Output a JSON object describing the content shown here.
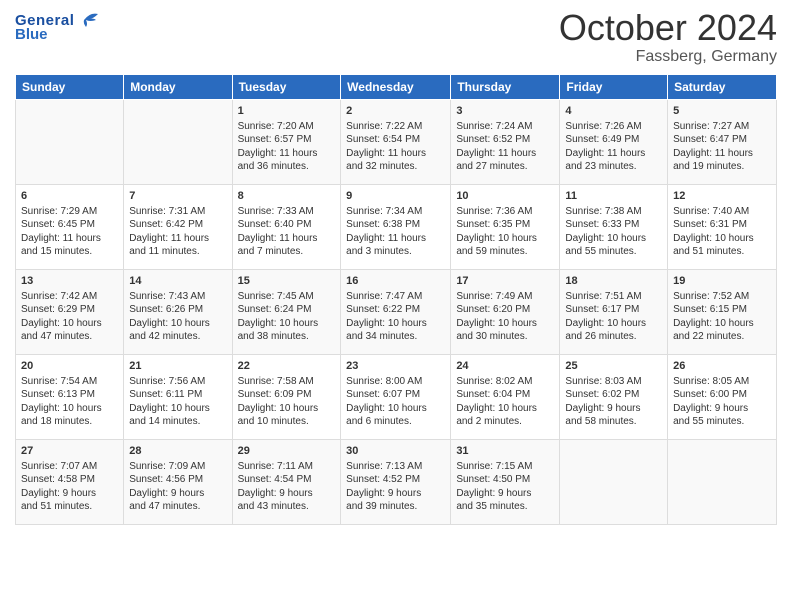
{
  "logo": {
    "text_general": "General",
    "text_blue": "Blue"
  },
  "header": {
    "month": "October 2024",
    "location": "Fassberg, Germany"
  },
  "weekdays": [
    "Sunday",
    "Monday",
    "Tuesday",
    "Wednesday",
    "Thursday",
    "Friday",
    "Saturday"
  ],
  "weeks": [
    [
      {
        "day": "",
        "lines": []
      },
      {
        "day": "",
        "lines": []
      },
      {
        "day": "1",
        "lines": [
          "Sunrise: 7:20 AM",
          "Sunset: 6:57 PM",
          "Daylight: 11 hours",
          "and 36 minutes."
        ]
      },
      {
        "day": "2",
        "lines": [
          "Sunrise: 7:22 AM",
          "Sunset: 6:54 PM",
          "Daylight: 11 hours",
          "and 32 minutes."
        ]
      },
      {
        "day": "3",
        "lines": [
          "Sunrise: 7:24 AM",
          "Sunset: 6:52 PM",
          "Daylight: 11 hours",
          "and 27 minutes."
        ]
      },
      {
        "day": "4",
        "lines": [
          "Sunrise: 7:26 AM",
          "Sunset: 6:49 PM",
          "Daylight: 11 hours",
          "and 23 minutes."
        ]
      },
      {
        "day": "5",
        "lines": [
          "Sunrise: 7:27 AM",
          "Sunset: 6:47 PM",
          "Daylight: 11 hours",
          "and 19 minutes."
        ]
      }
    ],
    [
      {
        "day": "6",
        "lines": [
          "Sunrise: 7:29 AM",
          "Sunset: 6:45 PM",
          "Daylight: 11 hours",
          "and 15 minutes."
        ]
      },
      {
        "day": "7",
        "lines": [
          "Sunrise: 7:31 AM",
          "Sunset: 6:42 PM",
          "Daylight: 11 hours",
          "and 11 minutes."
        ]
      },
      {
        "day": "8",
        "lines": [
          "Sunrise: 7:33 AM",
          "Sunset: 6:40 PM",
          "Daylight: 11 hours",
          "and 7 minutes."
        ]
      },
      {
        "day": "9",
        "lines": [
          "Sunrise: 7:34 AM",
          "Sunset: 6:38 PM",
          "Daylight: 11 hours",
          "and 3 minutes."
        ]
      },
      {
        "day": "10",
        "lines": [
          "Sunrise: 7:36 AM",
          "Sunset: 6:35 PM",
          "Daylight: 10 hours",
          "and 59 minutes."
        ]
      },
      {
        "day": "11",
        "lines": [
          "Sunrise: 7:38 AM",
          "Sunset: 6:33 PM",
          "Daylight: 10 hours",
          "and 55 minutes."
        ]
      },
      {
        "day": "12",
        "lines": [
          "Sunrise: 7:40 AM",
          "Sunset: 6:31 PM",
          "Daylight: 10 hours",
          "and 51 minutes."
        ]
      }
    ],
    [
      {
        "day": "13",
        "lines": [
          "Sunrise: 7:42 AM",
          "Sunset: 6:29 PM",
          "Daylight: 10 hours",
          "and 47 minutes."
        ]
      },
      {
        "day": "14",
        "lines": [
          "Sunrise: 7:43 AM",
          "Sunset: 6:26 PM",
          "Daylight: 10 hours",
          "and 42 minutes."
        ]
      },
      {
        "day": "15",
        "lines": [
          "Sunrise: 7:45 AM",
          "Sunset: 6:24 PM",
          "Daylight: 10 hours",
          "and 38 minutes."
        ]
      },
      {
        "day": "16",
        "lines": [
          "Sunrise: 7:47 AM",
          "Sunset: 6:22 PM",
          "Daylight: 10 hours",
          "and 34 minutes."
        ]
      },
      {
        "day": "17",
        "lines": [
          "Sunrise: 7:49 AM",
          "Sunset: 6:20 PM",
          "Daylight: 10 hours",
          "and 30 minutes."
        ]
      },
      {
        "day": "18",
        "lines": [
          "Sunrise: 7:51 AM",
          "Sunset: 6:17 PM",
          "Daylight: 10 hours",
          "and 26 minutes."
        ]
      },
      {
        "day": "19",
        "lines": [
          "Sunrise: 7:52 AM",
          "Sunset: 6:15 PM",
          "Daylight: 10 hours",
          "and 22 minutes."
        ]
      }
    ],
    [
      {
        "day": "20",
        "lines": [
          "Sunrise: 7:54 AM",
          "Sunset: 6:13 PM",
          "Daylight: 10 hours",
          "and 18 minutes."
        ]
      },
      {
        "day": "21",
        "lines": [
          "Sunrise: 7:56 AM",
          "Sunset: 6:11 PM",
          "Daylight: 10 hours",
          "and 14 minutes."
        ]
      },
      {
        "day": "22",
        "lines": [
          "Sunrise: 7:58 AM",
          "Sunset: 6:09 PM",
          "Daylight: 10 hours",
          "and 10 minutes."
        ]
      },
      {
        "day": "23",
        "lines": [
          "Sunrise: 8:00 AM",
          "Sunset: 6:07 PM",
          "Daylight: 10 hours",
          "and 6 minutes."
        ]
      },
      {
        "day": "24",
        "lines": [
          "Sunrise: 8:02 AM",
          "Sunset: 6:04 PM",
          "Daylight: 10 hours",
          "and 2 minutes."
        ]
      },
      {
        "day": "25",
        "lines": [
          "Sunrise: 8:03 AM",
          "Sunset: 6:02 PM",
          "Daylight: 9 hours",
          "and 58 minutes."
        ]
      },
      {
        "day": "26",
        "lines": [
          "Sunrise: 8:05 AM",
          "Sunset: 6:00 PM",
          "Daylight: 9 hours",
          "and 55 minutes."
        ]
      }
    ],
    [
      {
        "day": "27",
        "lines": [
          "Sunrise: 7:07 AM",
          "Sunset: 4:58 PM",
          "Daylight: 9 hours",
          "and 51 minutes."
        ]
      },
      {
        "day": "28",
        "lines": [
          "Sunrise: 7:09 AM",
          "Sunset: 4:56 PM",
          "Daylight: 9 hours",
          "and 47 minutes."
        ]
      },
      {
        "day": "29",
        "lines": [
          "Sunrise: 7:11 AM",
          "Sunset: 4:54 PM",
          "Daylight: 9 hours",
          "and 43 minutes."
        ]
      },
      {
        "day": "30",
        "lines": [
          "Sunrise: 7:13 AM",
          "Sunset: 4:52 PM",
          "Daylight: 9 hours",
          "and 39 minutes."
        ]
      },
      {
        "day": "31",
        "lines": [
          "Sunrise: 7:15 AM",
          "Sunset: 4:50 PM",
          "Daylight: 9 hours",
          "and 35 minutes."
        ]
      },
      {
        "day": "",
        "lines": []
      },
      {
        "day": "",
        "lines": []
      }
    ]
  ]
}
